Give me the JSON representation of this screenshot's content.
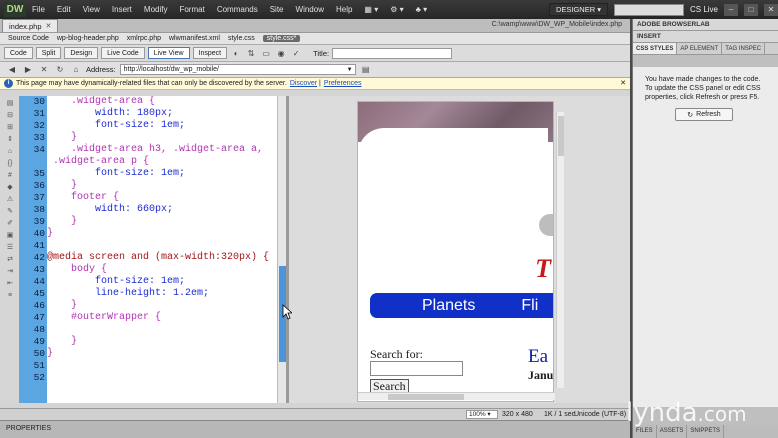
{
  "menubar": {
    "logo": "DW",
    "items": [
      "File",
      "Edit",
      "View",
      "Insert",
      "Modify",
      "Format",
      "Commands",
      "Site",
      "Window",
      "Help"
    ],
    "workspace": "DESIGNER ▾",
    "cslive": "CS Live"
  },
  "document": {
    "tab": "index.php",
    "path": "C:\\wamp\\www\\DW_WP_Mobile\\index.php",
    "related_files": [
      "Source Code",
      "wp-blog-header.php",
      "xmlrpc.php",
      "wlwmanifest.xml",
      "style.css",
      "style.css*"
    ],
    "toolbar": {
      "code": "Code",
      "split": "Split",
      "design": "Design",
      "live_code": "Live Code",
      "live_view": "Live View",
      "inspect": "Inspect",
      "title_label": "Title:"
    },
    "address_label": "Address:",
    "address_value": "http://localhost/dw_wp_mobile/",
    "info": {
      "text": "This page may have dynamically-related files that can only be discovered by the server.",
      "discover": "Discover",
      "preferences": "Preferences"
    }
  },
  "code": {
    "lines": [
      {
        "n": "30",
        "text": "    .widget-area {",
        "cls": "c-sel"
      },
      {
        "n": "31",
        "text": "        width: 180px;",
        "cls": "c-prop"
      },
      {
        "n": "32",
        "text": "        font-size: 1em;",
        "cls": "c-prop"
      },
      {
        "n": "33",
        "text": "    }",
        "cls": "c-brace"
      },
      {
        "n": "34",
        "text": "    .widget-area h3, .widget-area a,",
        "cls": "c-sel"
      },
      {
        "n": "",
        "text": " .widget-area p {",
        "cls": "c-sel"
      },
      {
        "n": "35",
        "text": "        font-size: 1em;",
        "cls": "c-prop"
      },
      {
        "n": "36",
        "text": "    }",
        "cls": "c-brace"
      },
      {
        "n": "37",
        "text": "    footer {",
        "cls": "c-sel"
      },
      {
        "n": "38",
        "text": "        width: 660px;",
        "cls": "c-prop"
      },
      {
        "n": "39",
        "text": "    }",
        "cls": "c-brace"
      },
      {
        "n": "40",
        "text": "}",
        "cls": "c-brace"
      },
      {
        "n": "41",
        "text": "",
        "cls": "c-prop"
      },
      {
        "n": "42",
        "text": "@media screen and (max-width:320px) {",
        "cls": "c-media"
      },
      {
        "n": "43",
        "text": "    body {",
        "cls": "c-sel"
      },
      {
        "n": "44",
        "text": "        font-size: 1em;",
        "cls": "c-prop"
      },
      {
        "n": "45",
        "text": "        line-height: 1.2em;",
        "cls": "c-prop"
      },
      {
        "n": "46",
        "text": "    }",
        "cls": "c-brace"
      },
      {
        "n": "47",
        "text": "    #outerWrapper {",
        "cls": "c-sel"
      },
      {
        "n": "48",
        "text": "",
        "cls": "c-prop"
      },
      {
        "n": "49",
        "text": "    }",
        "cls": "c-brace"
      },
      {
        "n": "50",
        "text": "}",
        "cls": "c-brace"
      },
      {
        "n": "51",
        "text": "",
        "cls": "c-prop"
      },
      {
        "n": "52",
        "text": "",
        "cls": "c-prop"
      }
    ]
  },
  "preview": {
    "nav_planets": "Planets",
    "nav_flights": "Fli",
    "search_label": "Search for:",
    "search_button": "Search",
    "heading_partial": "Ea",
    "date_partial": "Janu",
    "red_mark": "T"
  },
  "status": {
    "zoom": "100% ▾",
    "dimensions": "320 x 480",
    "size": "1K / 1 sec",
    "encoding": "Unicode (UTF-8)"
  },
  "properties_label": "PROPERTIES",
  "panel": {
    "browserlab": "ADOBE BROWSERLAB",
    "insert": "INSERT",
    "tabs": [
      "CSS STYLES",
      "AP ELEMENT",
      "TAG INSPEC"
    ],
    "message": "You have made changes to the code. To update the CSS panel or edit CSS properties, click Refresh or press F5.",
    "refresh": "Refresh",
    "bottom_tabs": [
      "FILES",
      "ASSETS",
      "SNIPPETS"
    ]
  },
  "watermark": {
    "brand": "lynda",
    "suffix": ".com"
  }
}
